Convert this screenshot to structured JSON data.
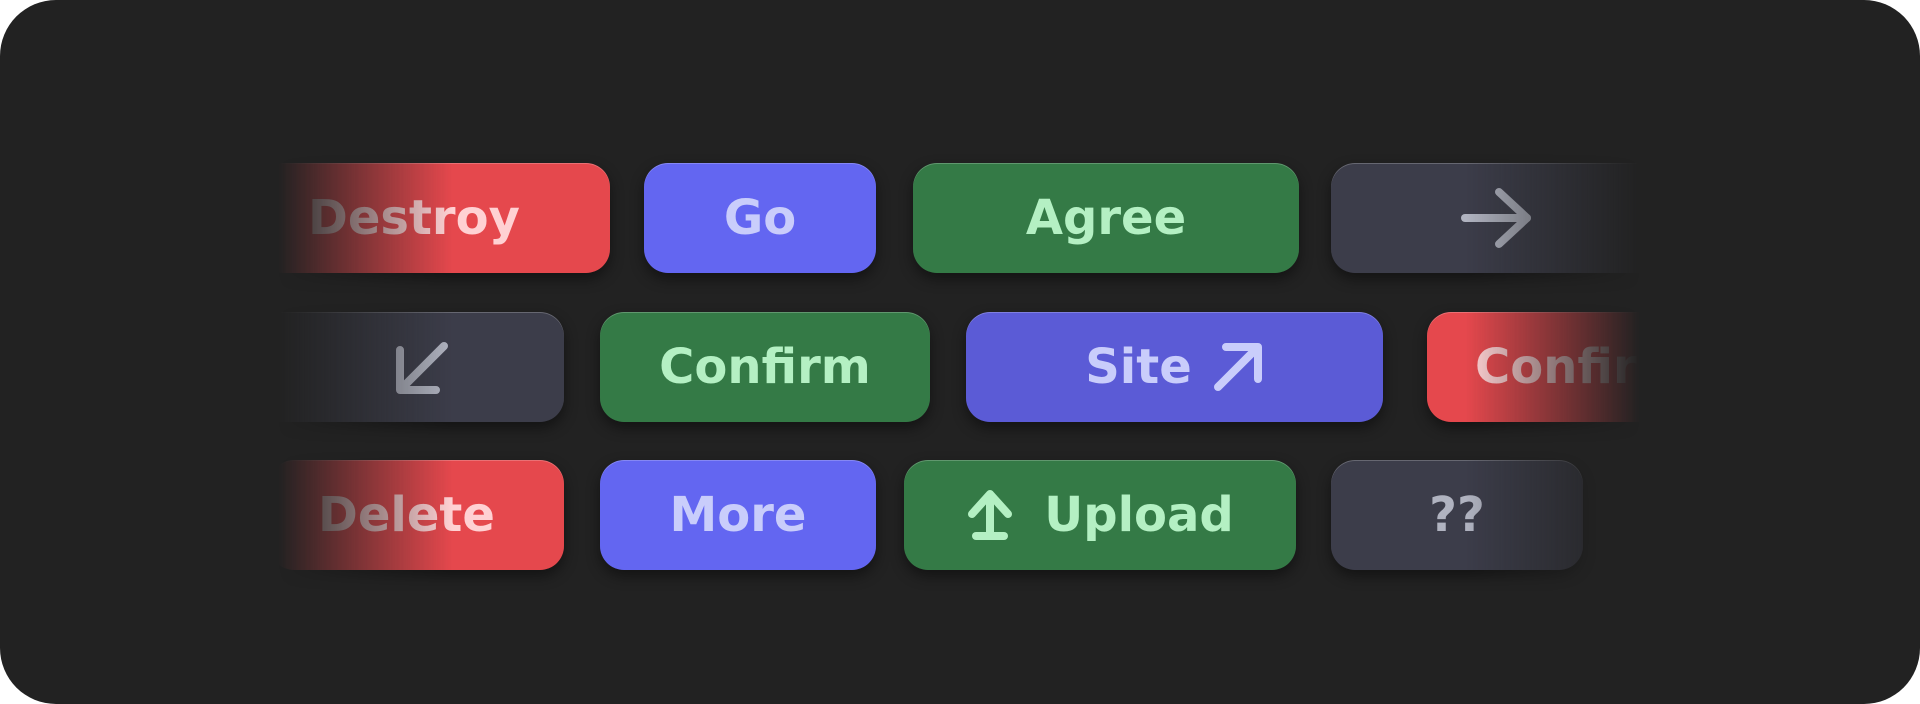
{
  "colors": {
    "background": "#222222",
    "red": "#e5484d",
    "indigo": "#5b5bd6",
    "green": "#347a46",
    "gray": "#3c3d4a"
  },
  "row1": {
    "destroy_label": "Destroy",
    "go_label": "Go",
    "agree_label": "Agree",
    "arrow_right_icon": "arrow-right-icon"
  },
  "row2": {
    "arrow_down_left_icon": "arrow-down-left-icon",
    "confirm_label": "Confirm",
    "site_label": "Site",
    "site_icon": "arrow-up-right-icon",
    "confirm_red_label": "Confirm"
  },
  "row3": {
    "delete_label": "Delete",
    "more_label": "More",
    "upload_icon": "arrow-up-icon",
    "upload_label": "Upload",
    "unknown_label": "??"
  }
}
